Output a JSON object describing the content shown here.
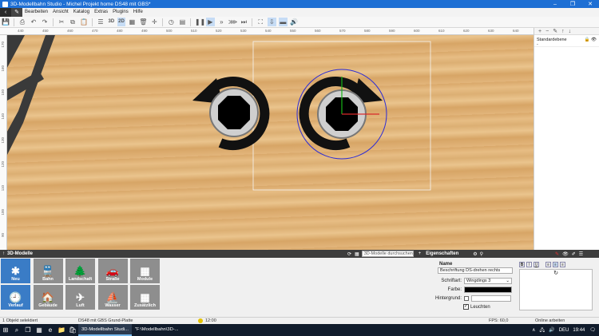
{
  "window": {
    "title": "3D-Modellbahn Studio - Michel Projekt home DS48 mit GBS*",
    "minimize": "–",
    "maximize": "❐",
    "close": "✕"
  },
  "menu": {
    "items": [
      "Bearbeiten",
      "Ansicht",
      "Katalog",
      "Extras",
      "Plugins",
      "Hilfe"
    ]
  },
  "toolbar": {
    "view2d": "2D",
    "view3d": "3D"
  },
  "ruler": {
    "top_labels": [
      "440",
      "450",
      "460",
      "470",
      "480",
      "490",
      "500",
      "510",
      "520",
      "530",
      "540",
      "550",
      "560",
      "570",
      "580",
      "590",
      "600",
      "610",
      "620",
      "630",
      "640"
    ],
    "left_labels": [
      "170",
      "160",
      "150",
      "140",
      "130",
      "120",
      "110",
      "100",
      "90"
    ]
  },
  "layers": {
    "item_name": "Standardebene",
    "item_sub": "-"
  },
  "bottom": {
    "panel_title": "3D-Modelle",
    "search_placeholder": "3D-Modelle durchsuchen",
    "props_title": "Eigenschaften",
    "tiles": [
      {
        "label": "Neu",
        "glyph": "✱"
      },
      {
        "label": "Bahn",
        "glyph": "🚆"
      },
      {
        "label": "Landschaft",
        "glyph": "🌲"
      },
      {
        "label": "Straße",
        "glyph": "🚗"
      },
      {
        "label": "Module",
        "glyph": "▦"
      },
      {
        "label": "Verlauf",
        "glyph": "🕘"
      },
      {
        "label": "Gebäude",
        "glyph": "🏠"
      },
      {
        "label": "Luft",
        "glyph": "✈"
      },
      {
        "label": "Wasser",
        "glyph": "⛵"
      },
      {
        "label": "Zusätzlich",
        "glyph": "▦"
      }
    ]
  },
  "properties": {
    "name_label": "Name",
    "name_value": "Beschriftung DS-drehen rechts",
    "font_label": "Schriftart:",
    "font_value": "Wingdings 3",
    "color_label": "Farbe:",
    "color_value": "#000000",
    "bg_label": "Hintergrund:",
    "glow_label": "Leuchten",
    "glow_checked": true,
    "preview_glyph": "↻",
    "format_buttons": [
      "B",
      "I",
      "U"
    ]
  },
  "status": {
    "selection": "1 Objekt selektiert",
    "base": "DS48 mit GBS Grund-Platte",
    "time_sim": "12:00",
    "fps": "FPS: 60,0",
    "mode": "Online arbeiten"
  },
  "taskbar": {
    "task1": "3D-Modellbahn Studi...",
    "task2": "\"F:\\Modellbahn\\3D-...",
    "lang": "DEU",
    "clock": "19:44"
  },
  "colors": {
    "accent": "#1e6fd4",
    "tile": "#8e8e8e",
    "tile_selected": "#3a7cc6",
    "gizmo_circle": "#2b2bd6"
  }
}
